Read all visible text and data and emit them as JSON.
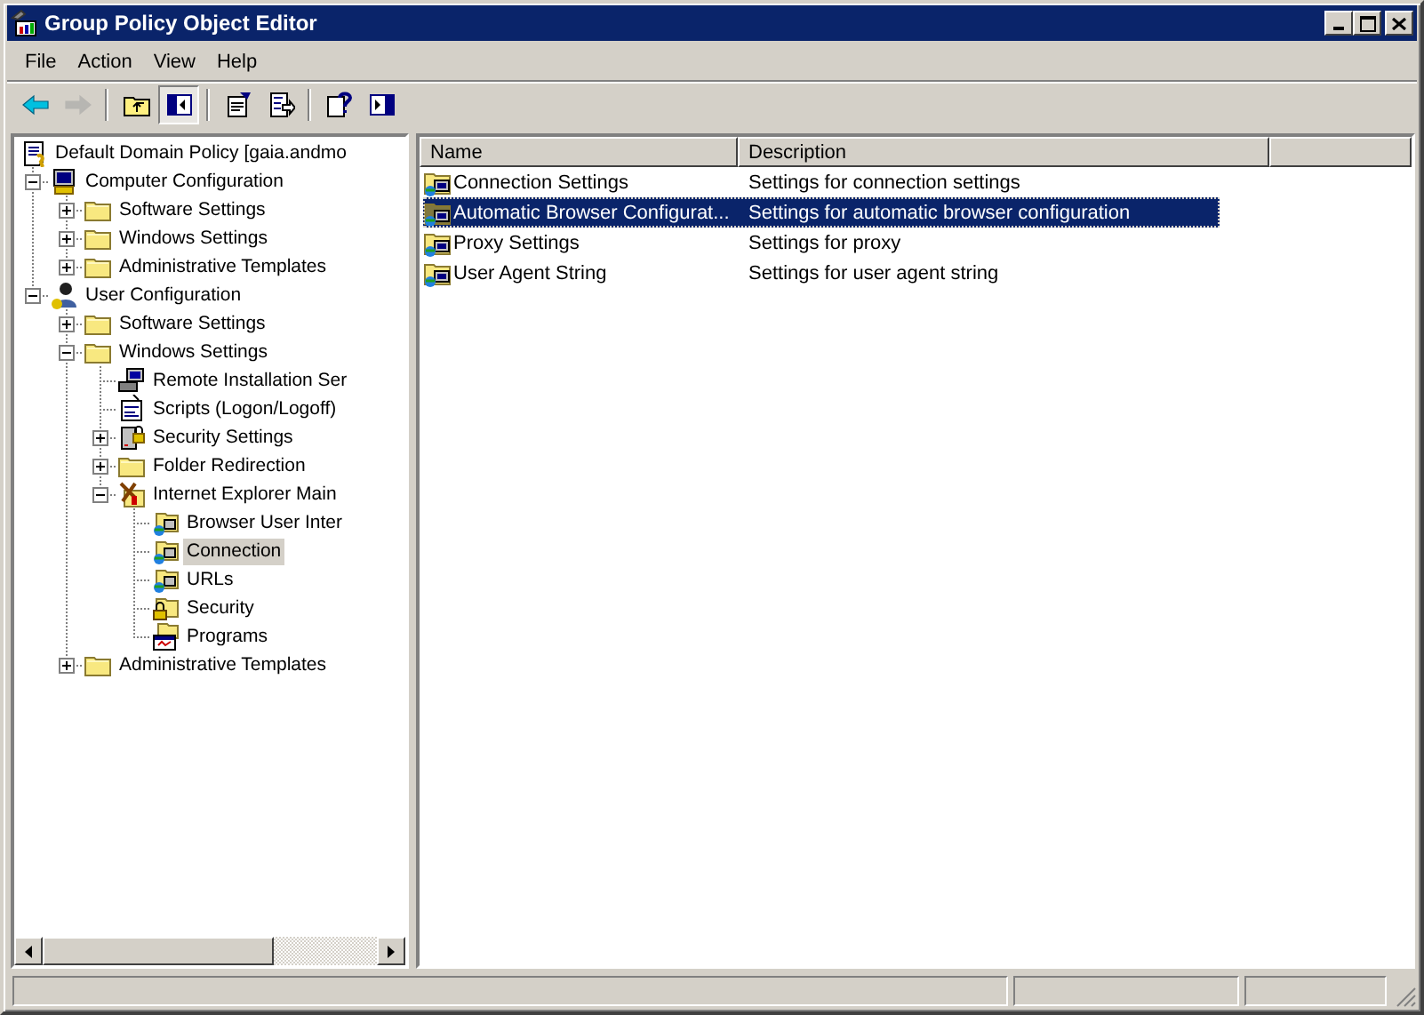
{
  "window": {
    "title": "Group Policy Object Editor"
  },
  "menu": [
    "File",
    "Action",
    "View",
    "Help"
  ],
  "toolbar": [
    {
      "kind": "back",
      "disabled": false,
      "pressed": false
    },
    {
      "kind": "forward",
      "disabled": true,
      "pressed": false
    },
    {
      "kind": "separator"
    },
    {
      "kind": "up",
      "disabled": false,
      "pressed": false
    },
    {
      "kind": "console-tree",
      "disabled": false,
      "pressed": true
    },
    {
      "kind": "separator"
    },
    {
      "kind": "properties",
      "disabled": false,
      "pressed": false
    },
    {
      "kind": "export",
      "disabled": false,
      "pressed": false
    },
    {
      "kind": "separator"
    },
    {
      "kind": "help",
      "disabled": false,
      "pressed": false
    },
    {
      "kind": "action-pane",
      "disabled": false,
      "pressed": false
    }
  ],
  "tree": [
    {
      "label": "Default Domain Policy [gaia.andmo",
      "kind": "policy",
      "selected": false,
      "children": [
        {
          "label": "Computer Configuration",
          "kind": "computer",
          "selected": false,
          "expanded": true,
          "children": [
            {
              "label": "Software Settings",
              "kind": "folder",
              "selected": false,
              "expanded": false
            },
            {
              "label": "Windows Settings",
              "kind": "folder",
              "selected": false,
              "expanded": false
            },
            {
              "label": "Administrative Templates",
              "kind": "folder",
              "selected": false,
              "expanded": false
            }
          ]
        },
        {
          "label": "User Configuration",
          "kind": "user",
          "selected": false,
          "expanded": true,
          "children": [
            {
              "label": "Software Settings",
              "kind": "folder",
              "selected": false,
              "expanded": false
            },
            {
              "label": "Windows Settings",
              "kind": "folder",
              "selected": false,
              "expanded": true,
              "children": [
                {
                  "label": "Remote Installation Ser",
                  "kind": "remote",
                  "selected": false
                },
                {
                  "label": "Scripts (Logon/Logoff)",
                  "kind": "script",
                  "selected": false
                },
                {
                  "label": "Security Settings",
                  "kind": "security",
                  "selected": false,
                  "expanded": false
                },
                {
                  "label": "Folder Redirection",
                  "kind": "folder",
                  "selected": false,
                  "expanded": false
                },
                {
                  "label": "Internet Explorer Main",
                  "kind": "tools",
                  "selected": false,
                  "expanded": true,
                  "children": [
                    {
                      "label": "Browser User Inter",
                      "kind": "ie-folder",
                      "selected": false
                    },
                    {
                      "label": "Connection",
                      "kind": "ie-folder",
                      "selected": true
                    },
                    {
                      "label": "URLs",
                      "kind": "ie-folder",
                      "selected": false
                    },
                    {
                      "label": "Security",
                      "kind": "lock-folder",
                      "selected": false
                    },
                    {
                      "label": "Programs",
                      "kind": "programs",
                      "selected": false
                    }
                  ]
                }
              ]
            },
            {
              "label": "Administrative Templates",
              "kind": "folder",
              "selected": false,
              "expanded": false
            }
          ]
        }
      ]
    }
  ],
  "list": {
    "columns": [
      "Name",
      "Description"
    ],
    "rows": [
      {
        "name": "Connection Settings",
        "description": "Settings for connection settings",
        "selected": false
      },
      {
        "name": "Automatic Browser Configurat...",
        "description": "Settings for automatic browser configuration",
        "selected": true
      },
      {
        "name": "Proxy Settings",
        "description": "Settings for proxy",
        "selected": false
      },
      {
        "name": "User Agent String",
        "description": "Settings for user agent string",
        "selected": false
      }
    ]
  }
}
